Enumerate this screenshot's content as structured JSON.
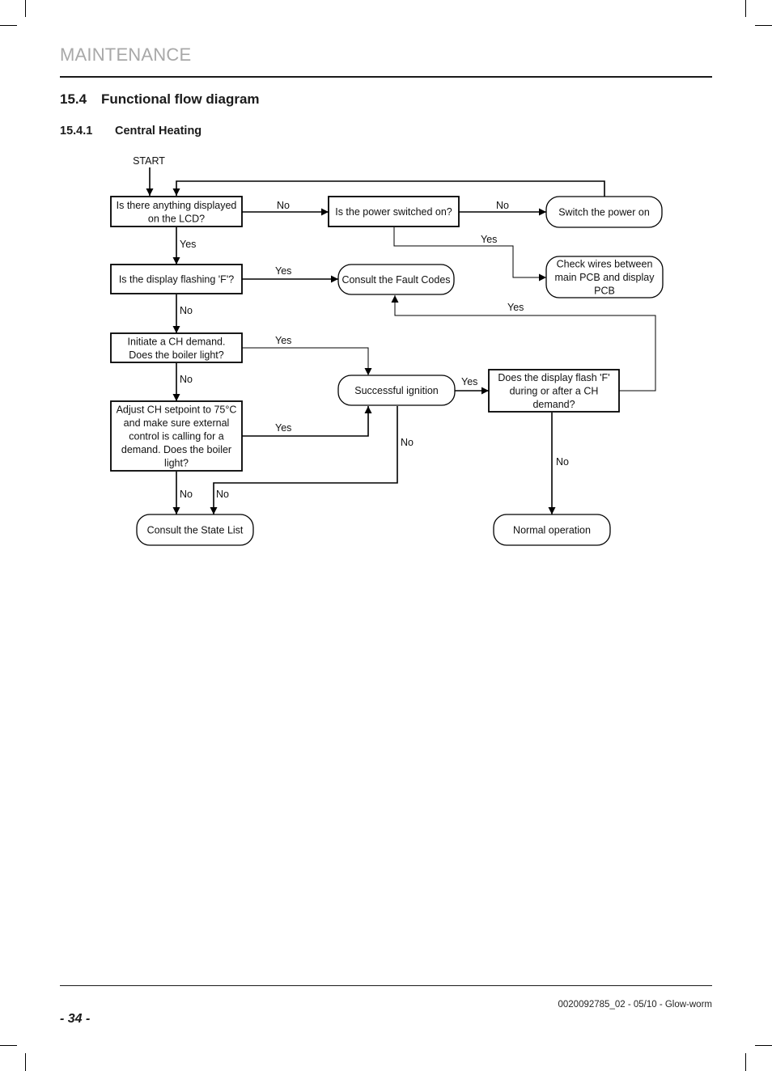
{
  "header": {
    "section": "MAINTENANCE"
  },
  "heading": {
    "number": "15.4",
    "title": "Functional flow diagram"
  },
  "subheading": {
    "number": "15.4.1",
    "title": "Central Heating"
  },
  "diagram": {
    "start_label": "START",
    "nodes": {
      "lcd_displayed": {
        "shape": "process",
        "lines": [
          "Is there anything displayed",
          "on the LCD?"
        ]
      },
      "power_on": {
        "shape": "process",
        "lines": [
          "Is the power switched on?"
        ]
      },
      "switch_power": {
        "shape": "terminal",
        "lines": [
          "Switch the power on"
        ]
      },
      "check_wires": {
        "shape": "terminal",
        "lines": [
          "Check wires between",
          "main PCB and display",
          "PCB"
        ]
      },
      "flashing_f": {
        "shape": "process",
        "lines": [
          "Is the display flashing 'F'?"
        ]
      },
      "fault_codes": {
        "shape": "terminal",
        "lines": [
          "Consult the Fault Codes"
        ]
      },
      "initiate_ch": {
        "shape": "process",
        "lines": [
          "Initiate a CH demand.",
          "Does the boiler light?"
        ]
      },
      "adjust_ch": {
        "shape": "process",
        "lines": [
          "Adjust CH setpoint to 75°C",
          "and make sure external",
          "control is calling for a",
          "demand. Does the boiler",
          "light?"
        ]
      },
      "ignition": {
        "shape": "terminal",
        "lines": [
          "Successful ignition"
        ]
      },
      "flash_after": {
        "shape": "process",
        "lines": [
          "Does the display flash 'F'",
          "during or after a CH",
          "demand?"
        ]
      },
      "state_list": {
        "shape": "terminal",
        "lines": [
          "Consult the State List"
        ]
      },
      "normal_op": {
        "shape": "terminal",
        "lines": [
          "Normal operation"
        ]
      }
    },
    "edges": [
      {
        "from": "start",
        "to": "lcd_displayed",
        "label": ""
      },
      {
        "from": "lcd_displayed",
        "to": "power_on",
        "label": "No"
      },
      {
        "from": "power_on",
        "to": "switch_power",
        "label": "No"
      },
      {
        "from": "switch_power",
        "to": "lcd_displayed",
        "label": ""
      },
      {
        "from": "power_on",
        "to": "check_wires",
        "label": "Yes"
      },
      {
        "from": "lcd_displayed",
        "to": "flashing_f",
        "label": "Yes"
      },
      {
        "from": "flashing_f",
        "to": "fault_codes",
        "label": "Yes"
      },
      {
        "from": "flashing_f",
        "to": "initiate_ch",
        "label": "No"
      },
      {
        "from": "initiate_ch",
        "to": "ignition",
        "label": "Yes"
      },
      {
        "from": "initiate_ch",
        "to": "adjust_ch",
        "label": "No"
      },
      {
        "from": "adjust_ch",
        "to": "ignition",
        "label": "Yes"
      },
      {
        "from": "adjust_ch",
        "to": "state_list",
        "label": "No"
      },
      {
        "from": "ignition",
        "to": "state_list",
        "label": "No"
      },
      {
        "from": "ignition",
        "to": "flash_after",
        "label": "Yes"
      },
      {
        "from": "flash_after",
        "to": "fault_codes",
        "label": "Yes"
      },
      {
        "from": "flash_after",
        "to": "normal_op",
        "label": "No"
      }
    ]
  },
  "footer": {
    "doc_ref": "0020092785_02 - 05/10 - Glow-worm",
    "page_number": "- 34 -"
  }
}
